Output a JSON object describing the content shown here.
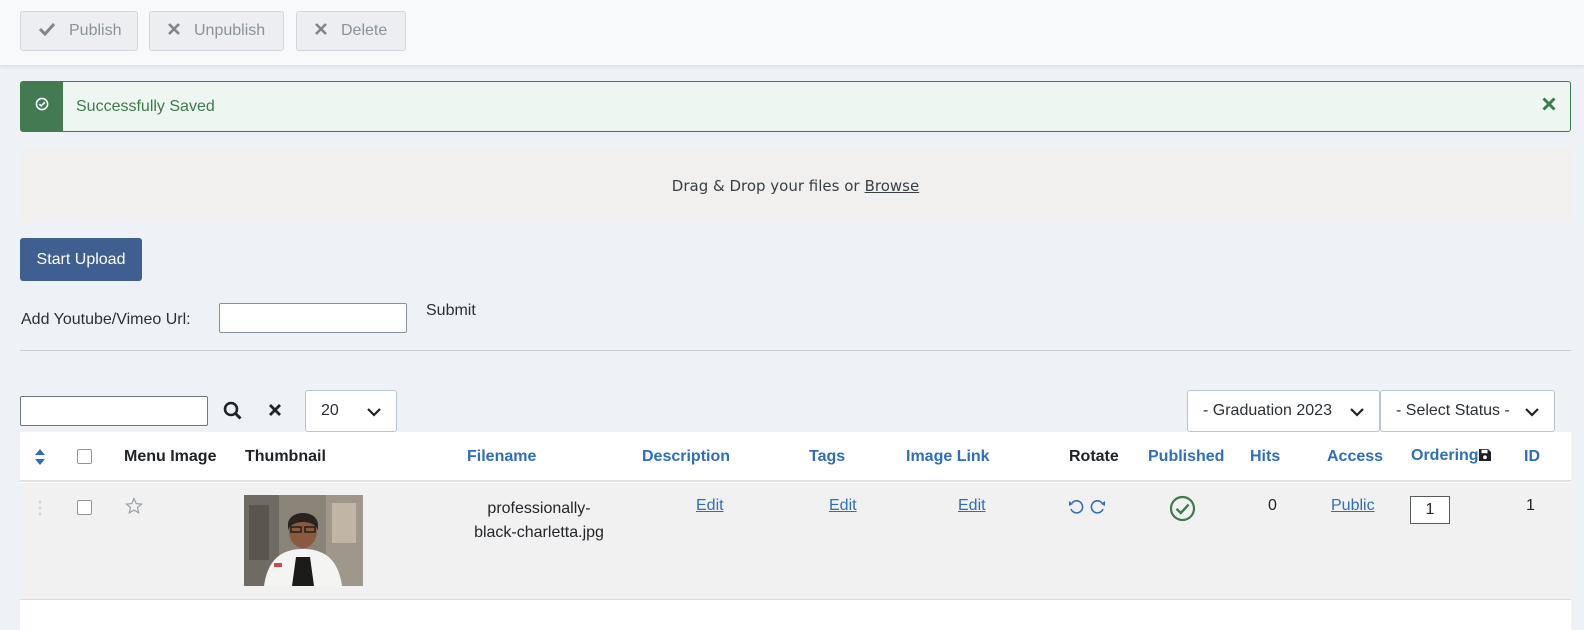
{
  "toolbar": {
    "publish_label": "Publish",
    "unpublish_label": "Unpublish",
    "delete_label": "Delete"
  },
  "alert": {
    "message": "Successfully Saved",
    "close_icon": "×"
  },
  "dropzone": {
    "text": "Drag & Drop your files or",
    "browse_label": "Browse"
  },
  "upload": {
    "start_label": "Start Upload"
  },
  "video": {
    "label": "Add Youtube/Vimeo Url:",
    "value": "",
    "submit_label": "Submit"
  },
  "filters": {
    "search_value": "",
    "limit": "20",
    "category": "- Graduation 2023",
    "status": "- Select Status -"
  },
  "table": {
    "headers": {
      "menu_image": "Menu Image",
      "thumbnail": "Thumbnail",
      "filename": "Filename",
      "description": "Description",
      "tags": "Tags",
      "image_link": "Image Link",
      "rotate": "Rotate",
      "published": "Published",
      "hits": "Hits",
      "access": "Access",
      "ordering": "Ordering",
      "id": "ID"
    },
    "rows": [
      {
        "filename_line1": "professionally-",
        "filename_line2": "black-charletta.jpg",
        "description": "Edit",
        "tags": "Edit",
        "image_link": "Edit",
        "hits": "0",
        "access": "Public",
        "ordering": "1",
        "id": "1",
        "published": true
      }
    ]
  },
  "colors": {
    "accent": "#3e5f8f",
    "link": "#2f6ebc",
    "success": "#447a52"
  }
}
